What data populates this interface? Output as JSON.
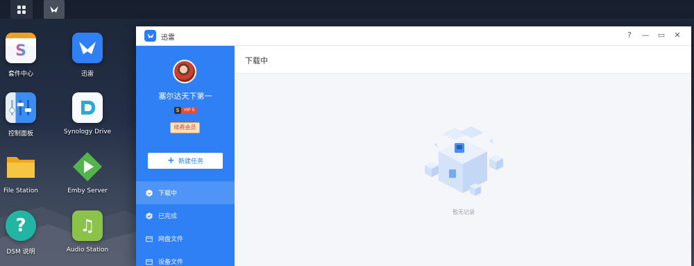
{
  "taskbar": {
    "main_menu_icon": "grid-icon",
    "running_app_icon": "thunder-bird-icon"
  },
  "desktop": {
    "icons": [
      {
        "label": "套件中心",
        "icon": "package-center-icon"
      },
      {
        "label": "迅雷",
        "icon": "thunder-bird-icon"
      },
      {
        "label": "控制面板",
        "icon": "control-panel-icon"
      },
      {
        "label": "Synology Drive",
        "icon": "synology-drive-icon"
      },
      {
        "label": "File Station",
        "icon": "folder-icon"
      },
      {
        "label": "Emby Server",
        "icon": "emby-play-icon"
      },
      {
        "label": "DSM 说明",
        "icon": "help-icon"
      },
      {
        "label": "Audio Station",
        "icon": "music-note-icon"
      }
    ]
  },
  "window": {
    "title": "迅雷",
    "controls": {
      "help": "?",
      "minimize": "—",
      "maximize": "▭",
      "close": "✕"
    },
    "accent_color": "#2f80f5"
  },
  "sidebar": {
    "username": "塞尔达天下第一",
    "vip_s": "S",
    "vip_label": "VIP 6",
    "renew_label": "续费会员",
    "new_task_label": "新建任务",
    "nav": [
      {
        "label": "下载中",
        "icon": "download-hexagon-icon",
        "active": true
      },
      {
        "label": "已完成",
        "icon": "check-shield-icon",
        "active": false
      },
      {
        "label": "网盘文件",
        "icon": "cloud-folder-icon",
        "active": false
      },
      {
        "label": "设备文件",
        "icon": "device-folder-icon",
        "active": false
      }
    ]
  },
  "main": {
    "header_title": "下载中",
    "empty_text": "暂无记录"
  }
}
